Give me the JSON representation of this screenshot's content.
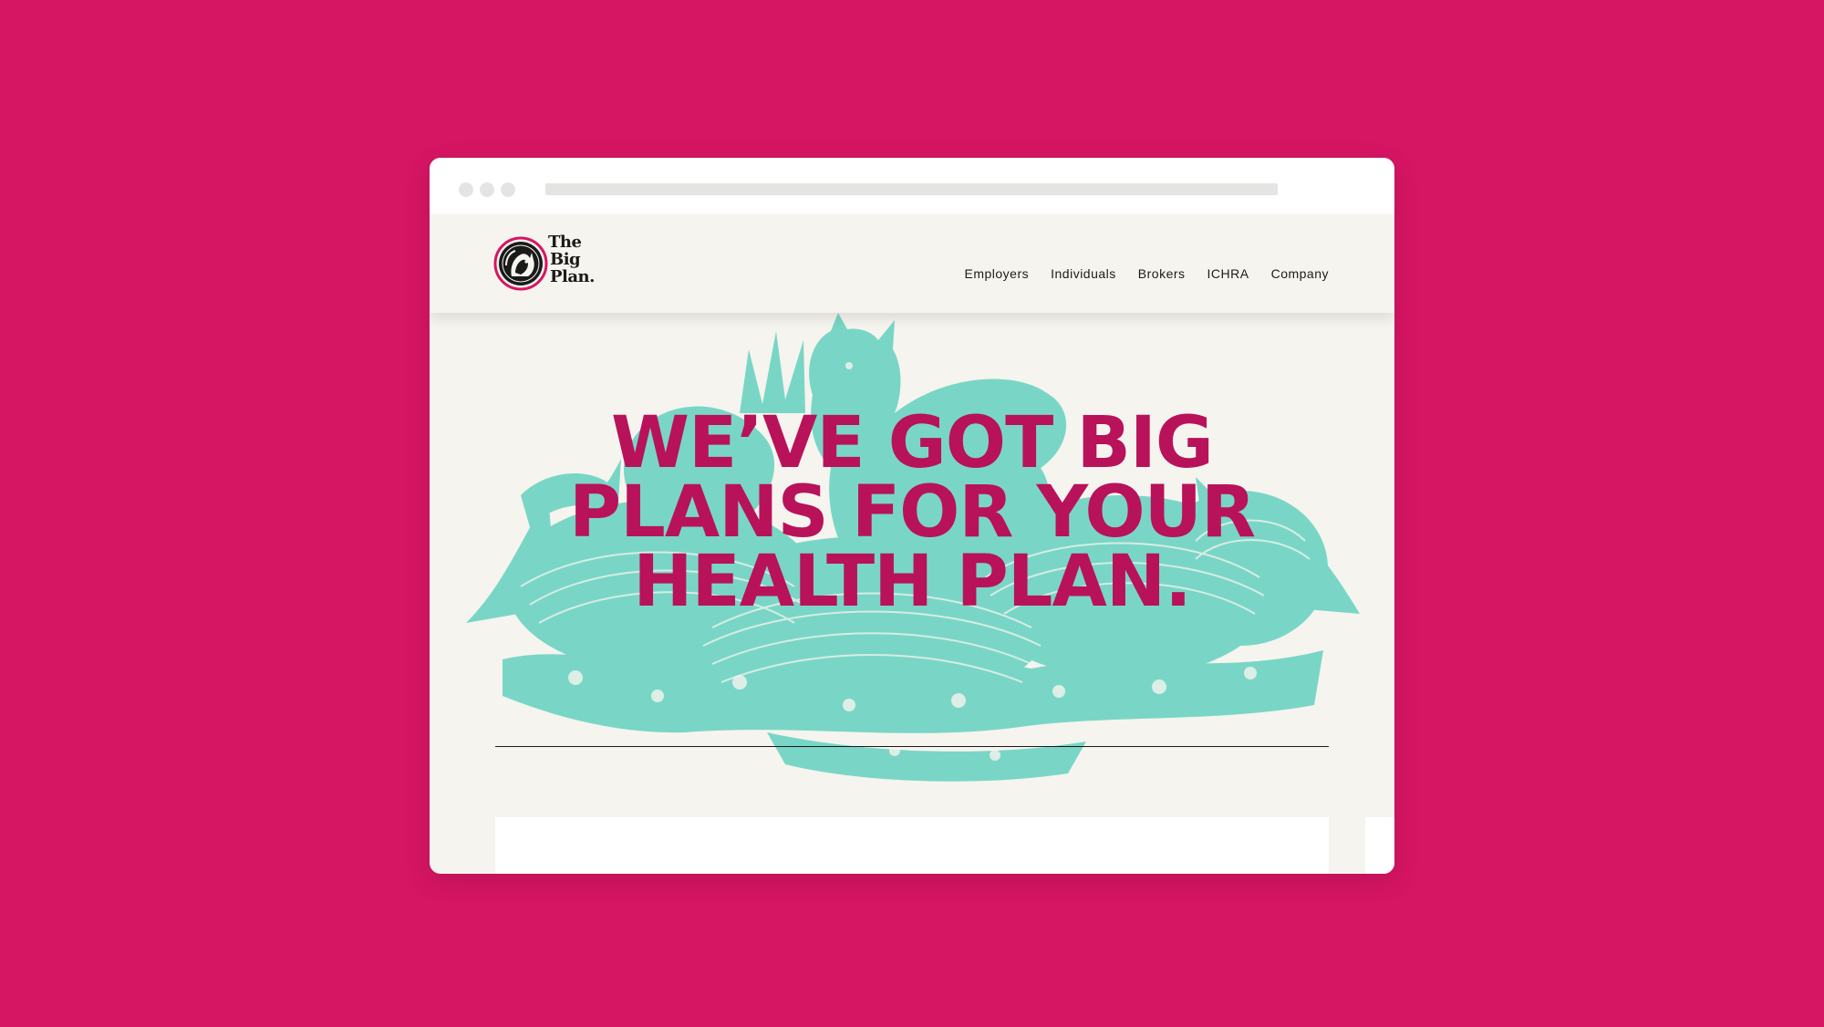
{
  "browser": {
    "window_controls": [
      "close",
      "minimize",
      "maximize"
    ]
  },
  "site": {
    "logo": {
      "icon": "squirrel-badge-icon",
      "wordmark": [
        "The",
        "Big",
        "Plan."
      ]
    },
    "nav": [
      {
        "label": "Employers"
      },
      {
        "label": "Individuals"
      },
      {
        "label": "Brokers"
      },
      {
        "label": "ICHRA"
      },
      {
        "label": "Company"
      }
    ]
  },
  "hero": {
    "headline_lines": [
      "WE’VE GOT BIG",
      "PLANS FOR YOUR",
      "HEALTH PLAN."
    ],
    "illustration": "squirrel-acorns-engraving"
  },
  "colors": {
    "background": "#d61563",
    "page": "#f5f4ee",
    "headline": "#b8125a",
    "illustration": "#79d6c6",
    "text": "#1b1b1b"
  }
}
